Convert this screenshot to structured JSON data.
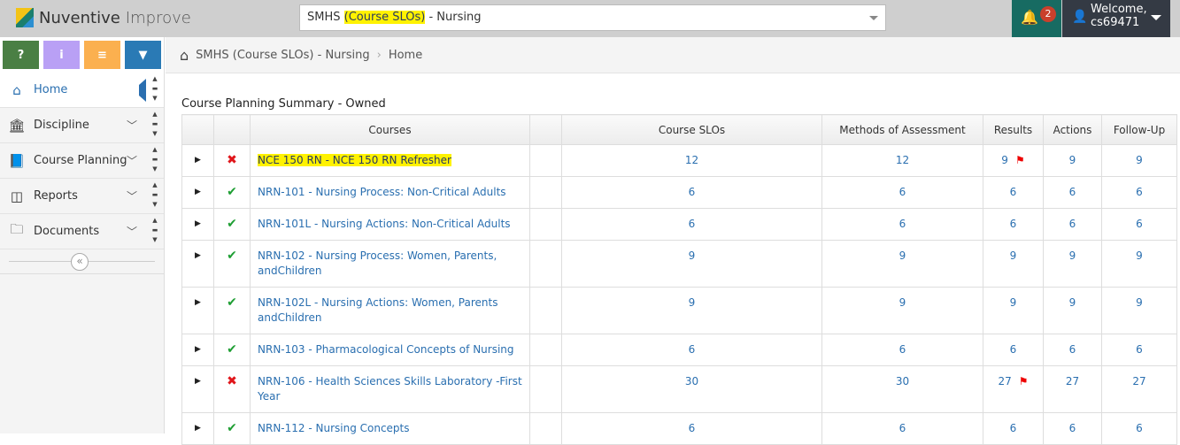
{
  "app": {
    "logo_brand": "Nuventive",
    "logo_product": "Improve"
  },
  "selector": {
    "prefix": "SMHS ",
    "highlight": "(Course SLOs)",
    "suffix": " - Nursing"
  },
  "notifications": {
    "count": "2"
  },
  "user": {
    "greeting": "Welcome,",
    "username": "cs69471"
  },
  "tools": [
    "?",
    "i",
    "≡",
    "▼"
  ],
  "sidebar": {
    "items": [
      {
        "label": "Home",
        "icon": "⌂"
      },
      {
        "label": "Discipline",
        "icon": "🏛"
      },
      {
        "label": "Course Planning",
        "icon": "📘"
      },
      {
        "label": "Reports",
        "icon": "◫"
      },
      {
        "label": "Documents",
        "icon": "🗀"
      }
    ]
  },
  "breadcrumb": {
    "root": "SMHS (Course SLOs) - Nursing",
    "current": "Home"
  },
  "section_title": "Course Planning Summary - Owned",
  "table": {
    "headers": [
      "Courses",
      "Course SLOs",
      "Methods of Assessment",
      "Results",
      "Actions",
      "Follow-Up"
    ],
    "rows": [
      {
        "status": "x",
        "course": "NCE 150 RN - NCE 150 RN Refresher",
        "slos": "12",
        "moa": "12",
        "results": "9",
        "flag": true,
        "actions": "9",
        "followup": "9"
      },
      {
        "status": "ok",
        "course": "NRN-101 - Nursing Process: Non-Critical Adults",
        "slos": "6",
        "moa": "6",
        "results": "6",
        "flag": false,
        "actions": "6",
        "followup": "6"
      },
      {
        "status": "ok",
        "course": "NRN-101L - Nursing Actions: Non-Critical Adults",
        "slos": "6",
        "moa": "6",
        "results": "6",
        "flag": false,
        "actions": "6",
        "followup": "6"
      },
      {
        "status": "ok",
        "course": "NRN-102 - Nursing Process: Women, Parents, andChildren",
        "slos": "9",
        "moa": "9",
        "results": "9",
        "flag": false,
        "actions": "9",
        "followup": "9"
      },
      {
        "status": "ok",
        "course": "NRN-102L - Nursing Actions: Women, Parents andChildren",
        "slos": "9",
        "moa": "9",
        "results": "9",
        "flag": false,
        "actions": "9",
        "followup": "9"
      },
      {
        "status": "ok",
        "course": "NRN-103 - Pharmacological Concepts of Nursing",
        "slos": "6",
        "moa": "6",
        "results": "6",
        "flag": false,
        "actions": "6",
        "followup": "6"
      },
      {
        "status": "x",
        "course": "NRN-106 - Health Sciences Skills Laboratory -First Year",
        "slos": "30",
        "moa": "30",
        "results": "27",
        "flag": true,
        "actions": "27",
        "followup": "27"
      },
      {
        "status": "ok",
        "course": "NRN-112 - Nursing Concepts",
        "slos": "6",
        "moa": "6",
        "results": "6",
        "flag": false,
        "actions": "6",
        "followup": "6"
      }
    ]
  }
}
